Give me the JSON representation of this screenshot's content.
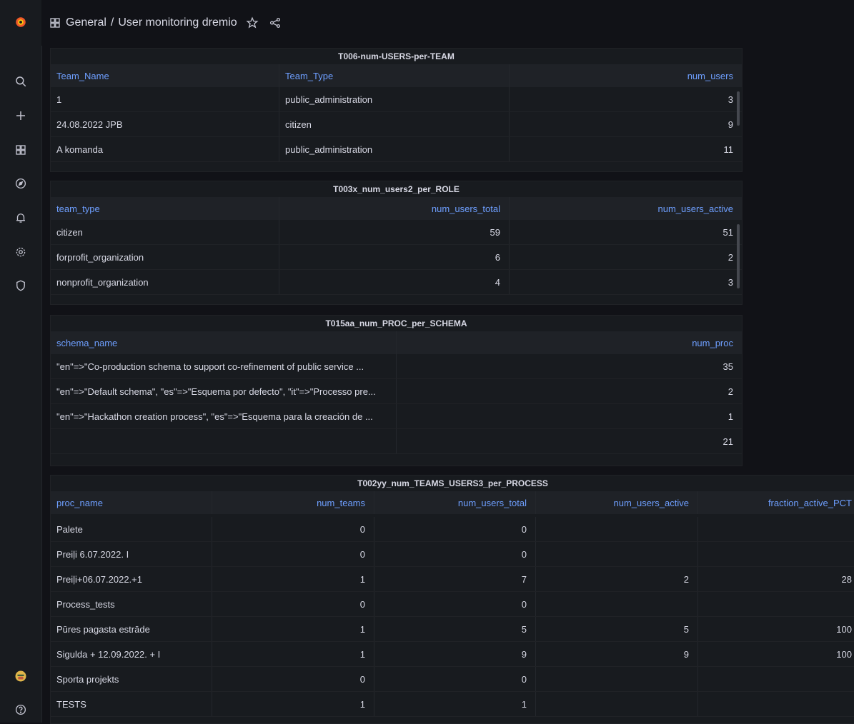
{
  "header": {
    "folder": "General",
    "separator": "/",
    "title": "User monitoring dremio"
  },
  "sidebar": {
    "icons": [
      "grafana-logo-icon",
      "search-icon",
      "plus-icon",
      "dashboards-icon",
      "explore-icon",
      "alerting-icon",
      "gear-icon",
      "shield-icon",
      "avatar",
      "help-icon"
    ]
  },
  "panels": {
    "teams": {
      "title": "T006-num-USERS-per-TEAM",
      "columns": [
        "Team_Name",
        "Team_Type",
        "num_users"
      ],
      "rows": [
        [
          "1",
          "public_administration",
          "3"
        ],
        [
          "24.08.2022 JPB",
          "citizen",
          "9"
        ],
        [
          "A komanda",
          "public_administration",
          "11"
        ]
      ]
    },
    "roles": {
      "title": "T003x_num_users2_per_ROLE",
      "columns": [
        "team_type",
        "num_users_total",
        "num_users_active"
      ],
      "rows": [
        [
          "citizen",
          "59",
          "51"
        ],
        [
          "forprofit_organization",
          "6",
          "2"
        ],
        [
          "nonprofit_organization",
          "4",
          "3"
        ]
      ]
    },
    "schemas": {
      "title": "T015aa_num_PROC_per_SCHEMA",
      "columns": [
        "schema_name",
        "num_proc"
      ],
      "rows": [
        [
          "\"en\"=>\"Co-production schema to support co-refinement of public service ...",
          "35"
        ],
        [
          "\"en\"=>\"Default schema\", \"es\"=>\"Esquema por defecto\", \"it\"=>\"Processo pre...",
          "2"
        ],
        [
          "\"en\"=>\"Hackathon creation process\", \"es\"=>\"Esquema para la creación de ...",
          "1"
        ],
        [
          "",
          "21"
        ]
      ]
    },
    "processes": {
      "title": "T002yy_num_TEAMS_USERS3_per_PROCESS",
      "columns": [
        "proc_name",
        "num_teams",
        "num_users_total",
        "num_users_active",
        "fraction_active_PCT"
      ],
      "rows": [
        [
          "Palete",
          "0",
          "0",
          "",
          ""
        ],
        [
          "Preiļi 6.07.2022. I",
          "0",
          "0",
          "",
          ""
        ],
        [
          "Preiļi+06.07.2022.+1",
          "1",
          "7",
          "2",
          "28"
        ],
        [
          "Process_tests",
          "0",
          "0",
          "",
          ""
        ],
        [
          "Pūres pagasta estrāde",
          "1",
          "5",
          "5",
          "100"
        ],
        [
          "Sigulda + 12.09.2022. + I",
          "1",
          "9",
          "9",
          "100"
        ],
        [
          "Sporta projekts",
          "0",
          "0",
          "",
          ""
        ],
        [
          "TESTS",
          "1",
          "1",
          "",
          ""
        ]
      ]
    }
  }
}
